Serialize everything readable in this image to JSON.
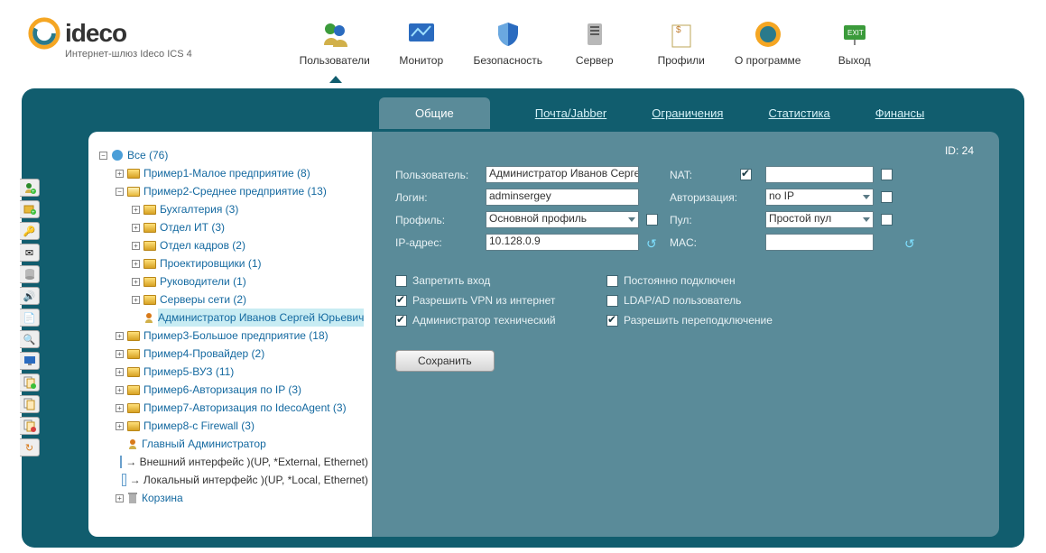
{
  "logo": {
    "text": "ideco",
    "subtitle": "Интернет-шлюз Ideco ICS 4"
  },
  "topnav": [
    {
      "label": "Пользователи",
      "active": true
    },
    {
      "label": "Монитор"
    },
    {
      "label": "Безопасность"
    },
    {
      "label": "Сервер"
    },
    {
      "label": "Профили"
    },
    {
      "label": "О программе"
    },
    {
      "label": "Выход"
    }
  ],
  "tabs": [
    {
      "label": "Общие",
      "active": true
    },
    {
      "label": "Почта/Jabber"
    },
    {
      "label": "Ограничения"
    },
    {
      "label": "Статистика"
    },
    {
      "label": "Финансы"
    }
  ],
  "tree": {
    "root": "Все (76)",
    "ex1": "Пример1-Малое предприятие (8)",
    "ex2": "Пример2-Среднее предприятие (13)",
    "ex2_children": {
      "buh": "Бухгалтерия (3)",
      "it": "Отдел ИТ (3)",
      "kadr": "Отдел кадров (2)",
      "proj": "Проектировщики (1)",
      "ruk": "Руководители (1)",
      "srv": "Серверы сети (2)",
      "admin": "Администратор Иванов Сергей Юрьевич"
    },
    "ex3": "Пример3-Большое предприятие (18)",
    "ex4": "Пример4-Провайдер (2)",
    "ex5": "Пример5-ВУЗ (11)",
    "ex6": "Пример6-Авторизация по IP (3)",
    "ex7": "Пример7-Авторизация по IdecoAgent (3)",
    "ex8": "Пример8-с Firewall (3)",
    "mainadmin": "Главный Администратор",
    "ext": "→ Внешний интерфейс )(UP, *External, Ethernet)",
    "loc": "→ Локальный интерфейс )(UP, *Local, Ethernet)",
    "trash": "Корзина"
  },
  "form": {
    "id_label": "ID:",
    "id_value": "24",
    "user_label": "Пользователь:",
    "user_value": "Администратор Иванов Сергей",
    "login_label": "Логин:",
    "login_value": "adminsergey",
    "profile_label": "Профиль:",
    "profile_value": "Основной профиль",
    "ip_label": "IP-адрес:",
    "ip_value": "10.128.0.9",
    "nat_label": "NAT:",
    "auth_label": "Авторизация:",
    "auth_value": "no IP",
    "pool_label": "Пул:",
    "pool_value": "Простой пул",
    "mac_label": "MAC:",
    "mac_value": ""
  },
  "checks": {
    "deny": "Запретить вход",
    "vpn": "Разрешить VPN из интернет",
    "admin": "Администратор технический",
    "perm": "Постоянно подключен",
    "ldap": "LDAP/AD пользователь",
    "reconn": "Разрешить переподключение"
  },
  "save": "Сохранить"
}
